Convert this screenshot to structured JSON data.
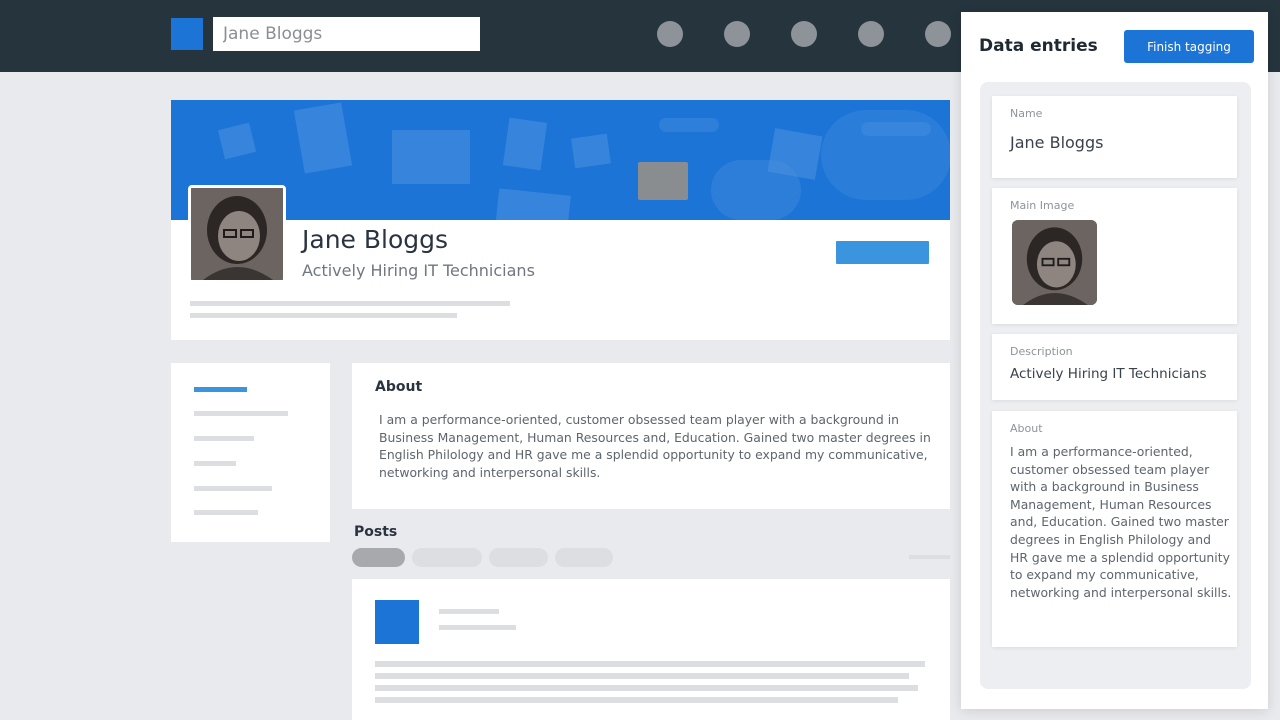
{
  "header": {
    "search_value": "Jane Bloggs",
    "nav_icons": [
      "nav-dot-icon",
      "nav-dot-icon",
      "nav-dot-icon",
      "nav-dot-icon",
      "nav-dot-icon"
    ]
  },
  "profile": {
    "name": "Jane Bloggs",
    "headline": "Actively Hiring IT Technicians"
  },
  "about": {
    "title": "About",
    "text": "I am a performance-oriented, customer obsessed team player with a background in Business Management, Human Resources and, Education. Gained two master degrees in English Philology and HR gave me a splendid opportunity to expand my communicative, networking and interpersonal skills."
  },
  "posts": {
    "title": "Posts"
  },
  "panel": {
    "title": "Data entries",
    "finish_label": "Finish tagging",
    "entries": {
      "name": {
        "label": "Name",
        "value": "Jane Bloggs"
      },
      "image": {
        "label": "Main Image"
      },
      "description": {
        "label": "Description",
        "value": "Actively Hiring IT Technicians"
      },
      "about": {
        "label": "About",
        "value": "I am a performance-oriented, customer obsessed team player with a background in Business Management, Human Resources and, Education. Gained two master degrees in English Philology and HR gave me a splendid opportunity to expand my communicative, networking and interpersonal skills."
      }
    }
  },
  "colors": {
    "topbar": "#26343d",
    "brand_blue": "#1c74d6",
    "button_light_blue": "#3b95de",
    "page_background": "#e9eaed"
  }
}
